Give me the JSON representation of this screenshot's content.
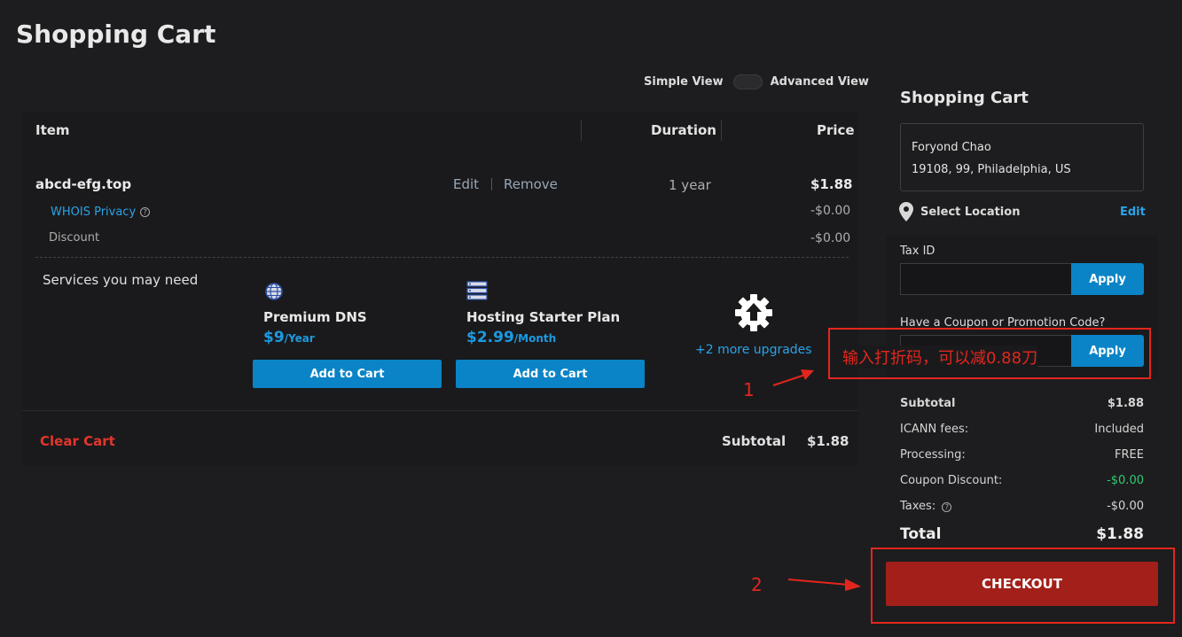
{
  "page": {
    "title": "Shopping Cart"
  },
  "view_toggle": {
    "simple": "Simple View",
    "advanced": "Advanced View"
  },
  "table": {
    "headers": {
      "item": "Item",
      "duration": "Duration",
      "price": "Price"
    },
    "item": {
      "name": "abcd-efg.top",
      "edit": "Edit",
      "remove": "Remove",
      "duration": "1 year",
      "price": "$1.88",
      "whois": "WHOIS Privacy",
      "whois_price": "-$0.00",
      "discount": "Discount",
      "discount_price": "-$0.00"
    },
    "services_label": "Services you may need",
    "services": [
      {
        "title": "Premium DNS",
        "price": "$9",
        "period": "/Year",
        "button": "Add to Cart",
        "icon": "globe-icon"
      },
      {
        "title": "Hosting Starter Plan",
        "price": "$2.99",
        "period": "/Month",
        "button": "Add to Cart",
        "icon": "server-icon"
      }
    ],
    "more_upgrades": "+2 more upgrades",
    "clear_cart": "Clear Cart",
    "subtotal_label": "Subtotal",
    "subtotal_value": "$1.88"
  },
  "sidebar": {
    "title": "Shopping Cart",
    "address_name": "Foryond Chao",
    "address_line": "19108, 99, Philadelphia, US",
    "select_location": "Select Location",
    "edit": "Edit",
    "tax_id_label": "Tax ID",
    "apply": "Apply",
    "coupon_label": "Have a Coupon or Promotion Code?",
    "summary": [
      {
        "label": "Subtotal",
        "value": "$1.88"
      },
      {
        "label": "ICANN fees:",
        "value": "Included"
      },
      {
        "label": "Processing:",
        "value": "FREE"
      },
      {
        "label": "Coupon Discount:",
        "value": "-$0.00"
      },
      {
        "label": "Taxes:",
        "value": "-$0.00"
      }
    ],
    "total_label": "Total",
    "total_value": "$1.88",
    "checkout": "CHECKOUT"
  },
  "annotations": {
    "coupon_note": "输入打折码，可以减0.88刀",
    "step1": "1",
    "step2": "2"
  },
  "colors": {
    "accent": "#0a84c6",
    "checkout": "#a31f19",
    "annotation": "#e3261d",
    "discount_green": "#2ecc71"
  }
}
